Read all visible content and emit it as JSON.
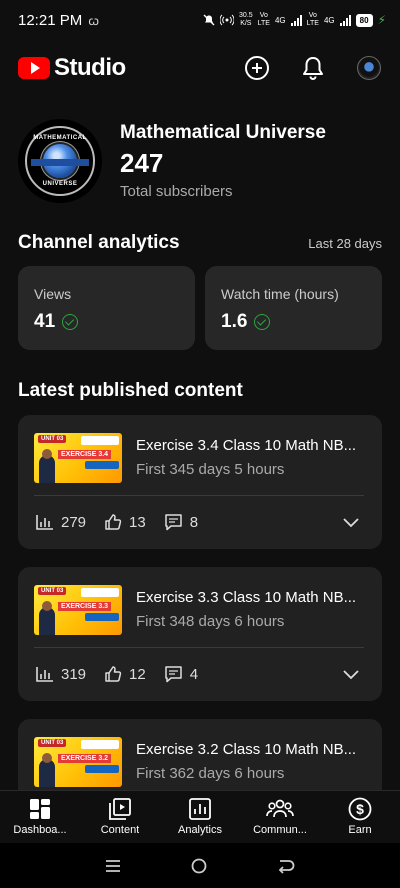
{
  "status_bar": {
    "time": "12:21 PM",
    "left_icon": "ꞷ",
    "speed_value": "30.5",
    "speed_unit": "K/S",
    "net1_label": "Vo",
    "net1_sub": "LTE",
    "net1_gen": "4G",
    "net2_label": "Vo",
    "net2_sub": "LTE",
    "net2_gen": "4G",
    "battery": "80"
  },
  "header": {
    "app_title": "Studio",
    "icons": [
      "youtube-logo-icon",
      "create-icon",
      "bell-icon",
      "account-avatar"
    ]
  },
  "channel": {
    "name": "Mathematical Universe",
    "subscribers": "247",
    "subscribers_label": "Total subscribers",
    "avatar_text_top": "MATHEMATICAL",
    "avatar_text_bottom": "UNIVERSE"
  },
  "analytics": {
    "title": "Channel analytics",
    "range": "Last 28 days",
    "stats": [
      {
        "label": "Views",
        "value": "41"
      },
      {
        "label": "Watch time (hours)",
        "value": "1.6"
      }
    ]
  },
  "latest": {
    "title": "Latest published content",
    "items": [
      {
        "title": "Exercise 3.4 Class 10 Math NB...",
        "subtitle": "First 345 days 5 hours",
        "views": "279",
        "likes": "13",
        "comments": "8",
        "thumb_unit": "UNIT 03",
        "thumb_ex": "EXERCISE 3.4"
      },
      {
        "title": "Exercise 3.3 Class 10 Math NB...",
        "subtitle": "First 348 days 6 hours",
        "views": "319",
        "likes": "12",
        "comments": "4",
        "thumb_unit": "UNIT 03",
        "thumb_ex": "EXERCISE 3.3"
      },
      {
        "title": "Exercise 3.2 Class 10 Math NB...",
        "subtitle": "First 362 days 6 hours",
        "views": "",
        "likes": "",
        "comments": "",
        "thumb_unit": "UNIT 03",
        "thumb_ex": "EXERCISE 3.2"
      }
    ]
  },
  "bottom_nav": [
    {
      "label": "Dashboa...",
      "icon": "dashboard-icon"
    },
    {
      "label": "Content",
      "icon": "content-icon"
    },
    {
      "label": "Analytics",
      "icon": "analytics-icon"
    },
    {
      "label": "Commun...",
      "icon": "community-icon"
    },
    {
      "label": "Earn",
      "icon": "earn-icon"
    }
  ],
  "colors": {
    "background": "#0f0f0f",
    "card": "#212121",
    "stat_card": "#272727",
    "accent_red": "#ff0000",
    "check_green": "#2ba640"
  }
}
